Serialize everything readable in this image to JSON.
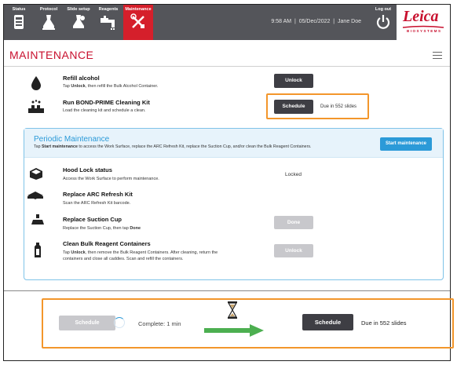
{
  "nav": {
    "items": [
      {
        "label": "Status"
      },
      {
        "label": "Protocol"
      },
      {
        "label": "Slide setup"
      },
      {
        "label": "Reagents"
      },
      {
        "label": "Maintenance"
      }
    ],
    "time": "9:58 AM",
    "date": "05/Dec/2022",
    "user": "Jane Doe",
    "logout_label": "Log out"
  },
  "brand": {
    "logo": "Leica",
    "sub": "BIOSYSTEMS"
  },
  "page": {
    "title": "MAINTENANCE"
  },
  "tasks": {
    "refill": {
      "title": "Refill alcohol",
      "desc_pre": "Tap ",
      "desc_bold": "Unlock",
      "desc_post": ", then refill the Bulk Alcohol Container.",
      "button": "Unlock"
    },
    "bond": {
      "title": "Run BOND-PRIME Cleaning Kit",
      "desc": "Load the cleaning kit and schedule a clean.",
      "button": "Schedule",
      "due": "Due in 552 slides"
    }
  },
  "periodic": {
    "title": "Periodic Maintenance",
    "desc_pre": "Tap ",
    "desc_bold": "Start maintenance",
    "desc_post": " to access the Work Surface, replace the ARC Refresh Kit, replace the Suction Cup, and/or clean the Bulk Reagent Containers.",
    "start_button": "Start maintenance",
    "items": {
      "hood": {
        "title": "Hood Lock status",
        "desc": "Access the Work Surface to perform maintenance.",
        "status": "Locked"
      },
      "arc": {
        "title": "Replace ARC Refresh Kit",
        "desc": "Scan the ARC Refresh Kit barcode."
      },
      "suction": {
        "title": "Replace Suction Cup",
        "desc_pre": "Replace the Suction Cup, then tap ",
        "desc_bold": "Done",
        "button": "Done"
      },
      "bulk": {
        "title": "Clean Bulk Reagent Containers",
        "desc_line1_pre": "Tap ",
        "desc_line1_bold": "Unlock",
        "desc_line1_post": ", then remove the Bulk Reagent Containers. After cleaning, return the",
        "desc_line2": "containers and close all caddies. Scan and refill the containers.",
        "button": "Unlock"
      }
    }
  },
  "transition": {
    "before_button": "Schedule",
    "complete_text": "Complete: 1 min",
    "after_button": "Schedule",
    "after_due": "Due in 552 slides"
  },
  "colors": {
    "accent_red": "#d51f2b",
    "highlight_orange": "#f3962b",
    "periodic_blue": "#2b9ad8",
    "arrow_green": "#4caf50",
    "button_dark": "#3e3e44",
    "button_disabled": "#c8c8cc"
  }
}
